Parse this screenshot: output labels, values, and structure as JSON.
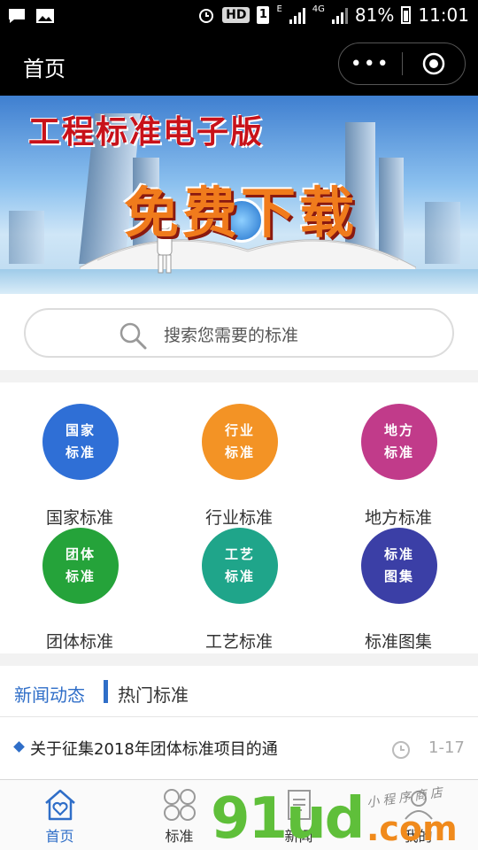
{
  "status_bar": {
    "hd": "HD",
    "sim": "1",
    "net_e": "E",
    "net_4g": "4G",
    "battery": "81%",
    "time": "11:01"
  },
  "header": {
    "title": "首页",
    "more_label": "•••"
  },
  "banner": {
    "subtitle": "工程标准电子版",
    "headline": "免费下载"
  },
  "search": {
    "placeholder": "搜索您需要的标准"
  },
  "categories": [
    {
      "icon_line1": "国家",
      "icon_line2": "标准",
      "label": "国家标准",
      "color": "#2f6fd6"
    },
    {
      "icon_line1": "行业",
      "icon_line2": "标准",
      "label": "行业标准",
      "color": "#f39325"
    },
    {
      "icon_line1": "地方",
      "icon_line2": "标准",
      "label": "地方标准",
      "color": "#c13b8a"
    },
    {
      "icon_line1": "团体",
      "icon_line2": "标准",
      "label": "团体标准",
      "color": "#25a33a"
    },
    {
      "icon_line1": "工艺",
      "icon_line2": "标准",
      "label": "工艺标准",
      "color": "#1fa58a"
    },
    {
      "icon_line1": "标准",
      "icon_line2": "图集",
      "label": "标准图集",
      "color": "#3b3fa6"
    }
  ],
  "news": {
    "tab_news": "新闻动态",
    "tab_hot": "热门标准",
    "items": [
      {
        "title": "关于征集2018年团体标准项目的通",
        "date": "1-17"
      }
    ]
  },
  "tabbar": {
    "items": [
      {
        "label": "首页",
        "icon": "home-heart-icon",
        "active": true
      },
      {
        "label": "标准",
        "icon": "grid-icon",
        "active": false
      },
      {
        "label": "新闻",
        "icon": "document-icon",
        "active": false
      },
      {
        "label": "我的",
        "icon": "user-icon",
        "active": false
      }
    ],
    "active_color": "#2f6ec8"
  },
  "watermark": {
    "main": "91ud",
    "suffix": ".com",
    "handwriting": "小程序商店"
  }
}
